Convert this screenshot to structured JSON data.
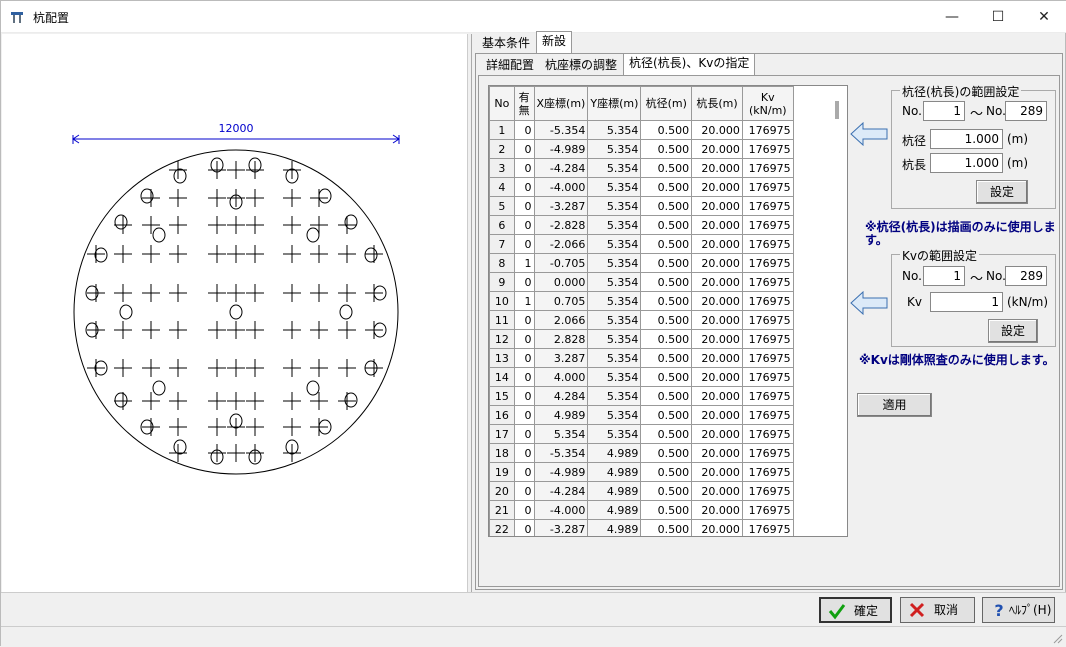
{
  "window": {
    "title": "杭配置",
    "minimize": "—",
    "maximize": "☐",
    "close": "✕"
  },
  "drawing": {
    "dimension_label": "12000"
  },
  "tabs_top": [
    "基本条件",
    "新設"
  ],
  "tabs_sub": [
    "詳細配置",
    "杭座標の調整",
    "杭径(杭長)、Kvの指定"
  ],
  "grid": {
    "headers": [
      "No",
      "有\n無",
      "X座標(m)",
      "Y座標(m)",
      "杭径(m)",
      "杭長(m)",
      "Kv\n(kN/m)"
    ],
    "rows": [
      [
        "1",
        "0",
        "-5.354",
        "5.354",
        "0.500",
        "20.000",
        "176975"
      ],
      [
        "2",
        "0",
        "-4.989",
        "5.354",
        "0.500",
        "20.000",
        "176975"
      ],
      [
        "3",
        "0",
        "-4.284",
        "5.354",
        "0.500",
        "20.000",
        "176975"
      ],
      [
        "4",
        "0",
        "-4.000",
        "5.354",
        "0.500",
        "20.000",
        "176975"
      ],
      [
        "5",
        "0",
        "-3.287",
        "5.354",
        "0.500",
        "20.000",
        "176975"
      ],
      [
        "6",
        "0",
        "-2.828",
        "5.354",
        "0.500",
        "20.000",
        "176975"
      ],
      [
        "7",
        "0",
        "-2.066",
        "5.354",
        "0.500",
        "20.000",
        "176975"
      ],
      [
        "8",
        "1",
        "-0.705",
        "5.354",
        "0.500",
        "20.000",
        "176975"
      ],
      [
        "9",
        "0",
        "0.000",
        "5.354",
        "0.500",
        "20.000",
        "176975"
      ],
      [
        "10",
        "1",
        "0.705",
        "5.354",
        "0.500",
        "20.000",
        "176975"
      ],
      [
        "11",
        "0",
        "2.066",
        "5.354",
        "0.500",
        "20.000",
        "176975"
      ],
      [
        "12",
        "0",
        "2.828",
        "5.354",
        "0.500",
        "20.000",
        "176975"
      ],
      [
        "13",
        "0",
        "3.287",
        "5.354",
        "0.500",
        "20.000",
        "176975"
      ],
      [
        "14",
        "0",
        "4.000",
        "5.354",
        "0.500",
        "20.000",
        "176975"
      ],
      [
        "15",
        "0",
        "4.284",
        "5.354",
        "0.500",
        "20.000",
        "176975"
      ],
      [
        "16",
        "0",
        "4.989",
        "5.354",
        "0.500",
        "20.000",
        "176975"
      ],
      [
        "17",
        "0",
        "5.354",
        "5.354",
        "0.500",
        "20.000",
        "176975"
      ],
      [
        "18",
        "0",
        "-5.354",
        "4.989",
        "0.500",
        "20.000",
        "176975"
      ],
      [
        "19",
        "0",
        "-4.989",
        "4.989",
        "0.500",
        "20.000",
        "176975"
      ],
      [
        "20",
        "0",
        "-4.284",
        "4.989",
        "0.500",
        "20.000",
        "176975"
      ],
      [
        "21",
        "0",
        "-4.000",
        "4.989",
        "0.500",
        "20.000",
        "176975"
      ],
      [
        "22",
        "0",
        "-3.287",
        "4.989",
        "0.500",
        "20.000",
        "176975"
      ]
    ]
  },
  "range_diameter": {
    "title": "杭径(杭長)の範囲設定",
    "no_label": "No.",
    "tilde": "〜",
    "no_label2": "No.",
    "from": "1",
    "to": "289",
    "diameter_label": "杭径",
    "diameter": "1.000",
    "diameter_unit": "(m)",
    "length_label": "杭長",
    "length": "1.000",
    "length_unit": "(m)",
    "set_button": "設定"
  },
  "note1": "※杭径(杭長)は描画のみに使用します。",
  "range_kv": {
    "title": "Kvの範囲設定",
    "no_label": "No.",
    "tilde": "〜",
    "no_label2": "No.",
    "from": "1",
    "to": "289",
    "kv_label": "Kv",
    "kv": "1",
    "kv_unit": "(kN/m)",
    "set_button": "設定"
  },
  "note2": "※Kvは剛体照査のみに使用します。",
  "apply_button": "適用",
  "footer": {
    "ok": "確定",
    "cancel": "取消",
    "help": "ﾍﾙﾌﾟ(H)"
  },
  "colors": {
    "dimension": "#0000cc",
    "arrow_fill": "#dceaf8",
    "arrow_stroke": "#3a6fb0",
    "note": "#000080"
  }
}
